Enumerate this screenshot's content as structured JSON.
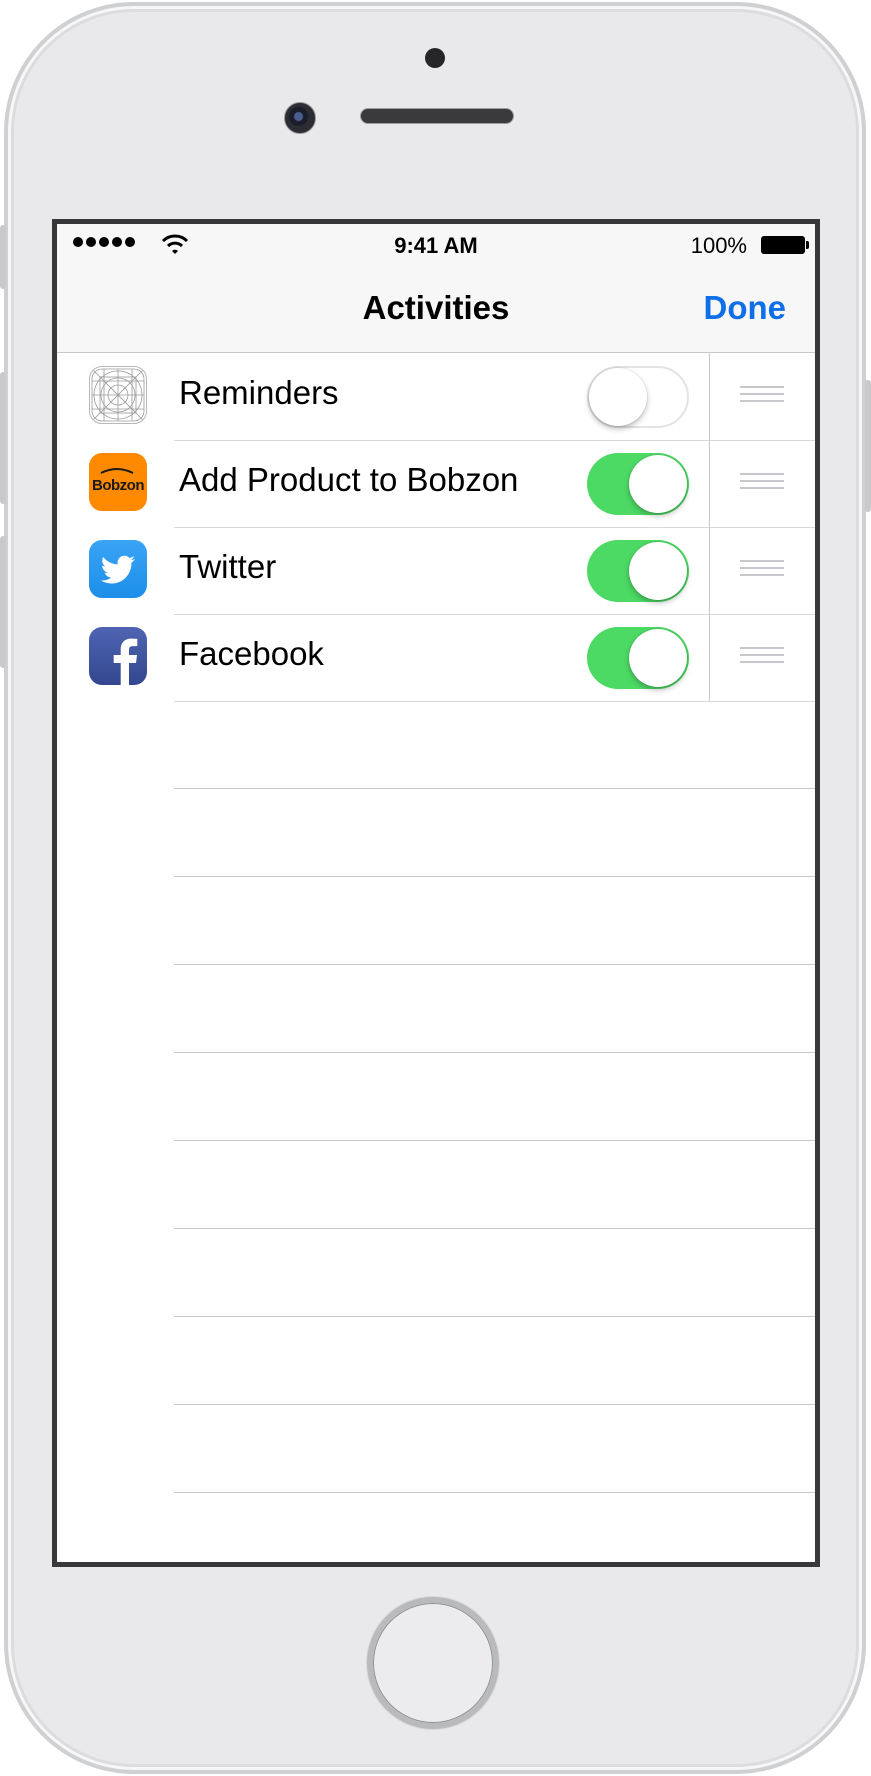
{
  "status_bar": {
    "time": "9:41 AM",
    "battery": "100%"
  },
  "nav": {
    "title": "Activities",
    "done_label": "Done",
    "accent_color": "#0f6fe8"
  },
  "activities": [
    {
      "label": "Reminders",
      "icon": "reminders-icon",
      "enabled": false
    },
    {
      "label": "Add Product to Bobzon",
      "icon": "bobzon-icon",
      "icon_text": "Bobzon",
      "enabled": true
    },
    {
      "label": "Twitter",
      "icon": "twitter-icon",
      "enabled": true
    },
    {
      "label": "Facebook",
      "icon": "facebook-icon",
      "enabled": true
    }
  ],
  "colors": {
    "toggle_on": "#4cd964",
    "bobzon": "#ff8a00",
    "twitter": "#1c8ee9",
    "facebook": "#33468f"
  }
}
